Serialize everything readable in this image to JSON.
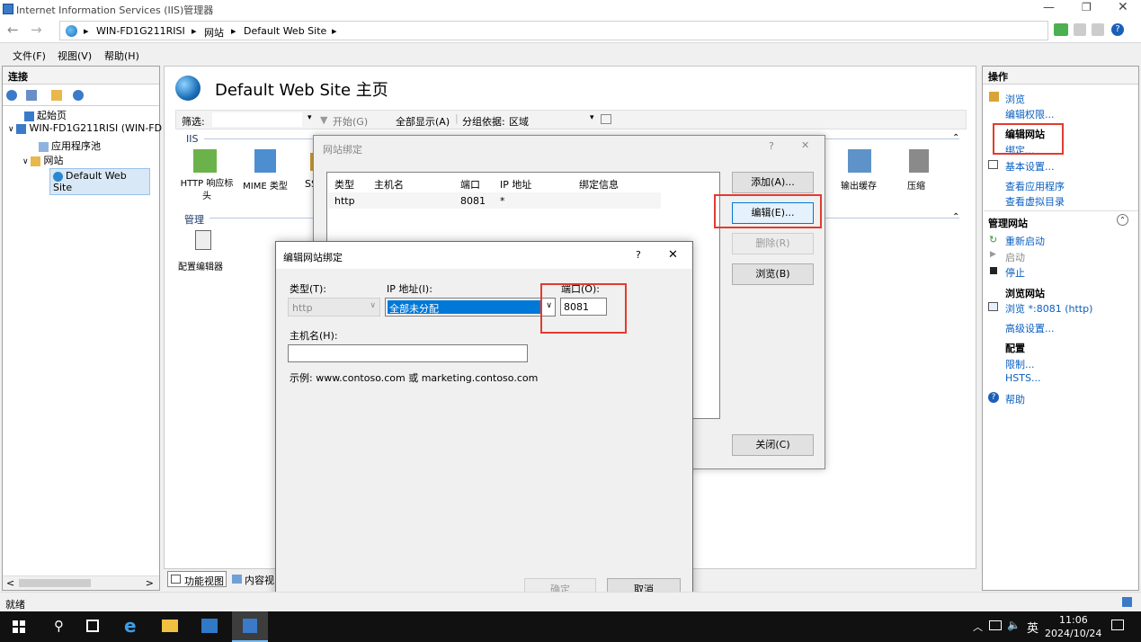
{
  "window": {
    "title": "Internet Information Services (IIS)管理器"
  },
  "address": {
    "crumbs": [
      "WIN-FD1G211RISI",
      "网站",
      "Default Web Site"
    ]
  },
  "menu": [
    "文件(F)",
    "视图(V)",
    "帮助(H)"
  ],
  "connections": {
    "title": "连接",
    "tree": [
      "起始页",
      "WIN-FD1G211RISI (WIN-FD",
      "应用程序池",
      "网站",
      "Default Web Site"
    ]
  },
  "center": {
    "title": "Default Web Site 主页",
    "filter_label": "筛选:",
    "start_label": "开始(G)",
    "show_all_label": "全部显示(A)",
    "group_label": "分组依据:",
    "group_value": "区域",
    "iis_section": "IIS",
    "mgmt_section": "管理",
    "features": [
      "HTTP 响应标头",
      "MIME 类型",
      "SS"
    ],
    "right_features": [
      "输出缓存",
      "压缩"
    ],
    "mgmt_features": [
      "配置编辑器"
    ],
    "view_tabs": [
      "功能视图",
      "内容视"
    ]
  },
  "bindings_dialog": {
    "title": "网站绑定",
    "help": "?",
    "close": "✕",
    "columns": [
      "类型",
      "主机名",
      "端口",
      "IP 地址",
      "绑定信息"
    ],
    "rows": [
      [
        "http",
        "",
        "8081",
        "*",
        ""
      ]
    ],
    "add": "添加(A)...",
    "edit": "编辑(E)...",
    "remove": "删除(R)",
    "browse": "浏览(B)",
    "close_btn": "关闭(C)"
  },
  "edit_dialog": {
    "title": "编辑网站绑定",
    "help": "?",
    "close": "✕",
    "type_label": "类型(T):",
    "type_value": "http",
    "ip_label": "IP 地址(I):",
    "ip_value": "全部未分配",
    "port_label": "端口(O):",
    "port_value": "8081",
    "host_label": "主机名(H):",
    "host_value": "",
    "example": "示例: www.contoso.com 或 marketing.contoso.com",
    "ok": "确定",
    "cancel": "取消"
  },
  "actions": {
    "title": "操作",
    "browse": "浏览",
    "edit_perms": "编辑权限...",
    "edit_site": "编辑网站",
    "bindings": "绑定...",
    "basic": "基本设置...",
    "view_apps": "查看应用程序",
    "view_vdirs": "查看虚拟目录",
    "manage_site": "管理网站",
    "restart": "重新启动",
    "start": "启动",
    "stop": "停止",
    "browse_site": "浏览网站",
    "browse_link": "浏览 *:8081 (http)",
    "advanced": "高级设置...",
    "config": "配置",
    "limits": "限制...",
    "hsts": "HSTS...",
    "help": "帮助"
  },
  "status": {
    "text": "就绪"
  },
  "taskbar": {
    "time": "11:06",
    "date": "2024/10/24",
    "lang": "英"
  },
  "colors": {
    "highlight": "#0078d7",
    "annot": "#e23b2e"
  }
}
